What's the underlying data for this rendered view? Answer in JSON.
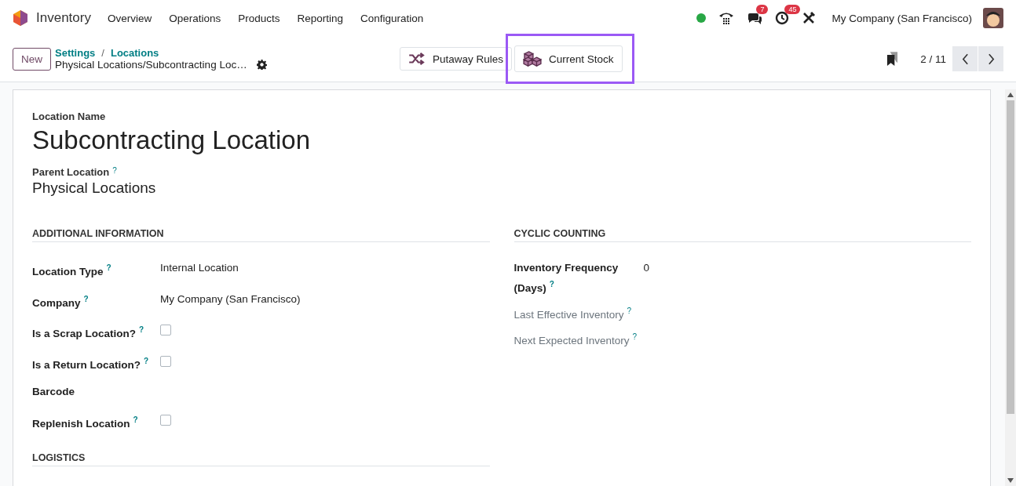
{
  "navbar": {
    "app_name": "Inventory",
    "menus": [
      "Overview",
      "Operations",
      "Products",
      "Reporting",
      "Configuration"
    ],
    "online": true,
    "messages_count": "7",
    "activities_count": "45",
    "company": "My Company (San Francisco)"
  },
  "control_panel": {
    "new_button": "New",
    "breadcrumbs": [
      "Settings",
      "Locations"
    ],
    "breadcrumb_separator": "/",
    "record_path": "Physical Locations/Subcontracting Loc…",
    "smart_buttons": [
      {
        "label": "Putaway Rules",
        "kind": "shuffle",
        "highlighted": false
      },
      {
        "label": "Current Stock",
        "kind": "boxes",
        "highlighted": true
      }
    ],
    "pager": "2 / 11"
  },
  "form": {
    "name_label": "Location Name",
    "name": "Subcontracting Location",
    "parent_label": "Parent Location",
    "parent_help": "?",
    "parent": "Physical Locations",
    "groups": [
      {
        "title": "ADDITIONAL INFORMATION",
        "fields": [
          {
            "label": "Location Type",
            "help": "?",
            "kind": "text",
            "value": "Internal Location",
            "readonly": false
          },
          {
            "label": "Company",
            "help": "?",
            "kind": "text",
            "value": "My Company (San Francisco)",
            "readonly": false
          },
          {
            "label": "Is a Scrap Location?",
            "help": "?",
            "kind": "checkbox",
            "checked": false,
            "readonly": false
          },
          {
            "label": "Is a Return Location?",
            "help": "?",
            "kind": "checkbox",
            "checked": false,
            "readonly": false
          },
          {
            "label": "Barcode",
            "kind": "empty",
            "readonly": false
          },
          {
            "label": "Replenish Location",
            "help": "?",
            "kind": "checkbox",
            "checked": false,
            "readonly": false
          }
        ]
      },
      {
        "title": "CYCLIC COUNTING",
        "fields": [
          {
            "label": "Inventory Frequency (Days)",
            "help": "?",
            "kind": "text",
            "value": "0",
            "readonly": false
          },
          {
            "label": "Last Effective Inventory",
            "help": "?",
            "kind": "empty",
            "readonly": true
          },
          {
            "label": "Next Expected Inventory",
            "help": "?",
            "kind": "empty",
            "readonly": true
          }
        ]
      },
      {
        "title": "LOGISTICS"
      }
    ]
  }
}
